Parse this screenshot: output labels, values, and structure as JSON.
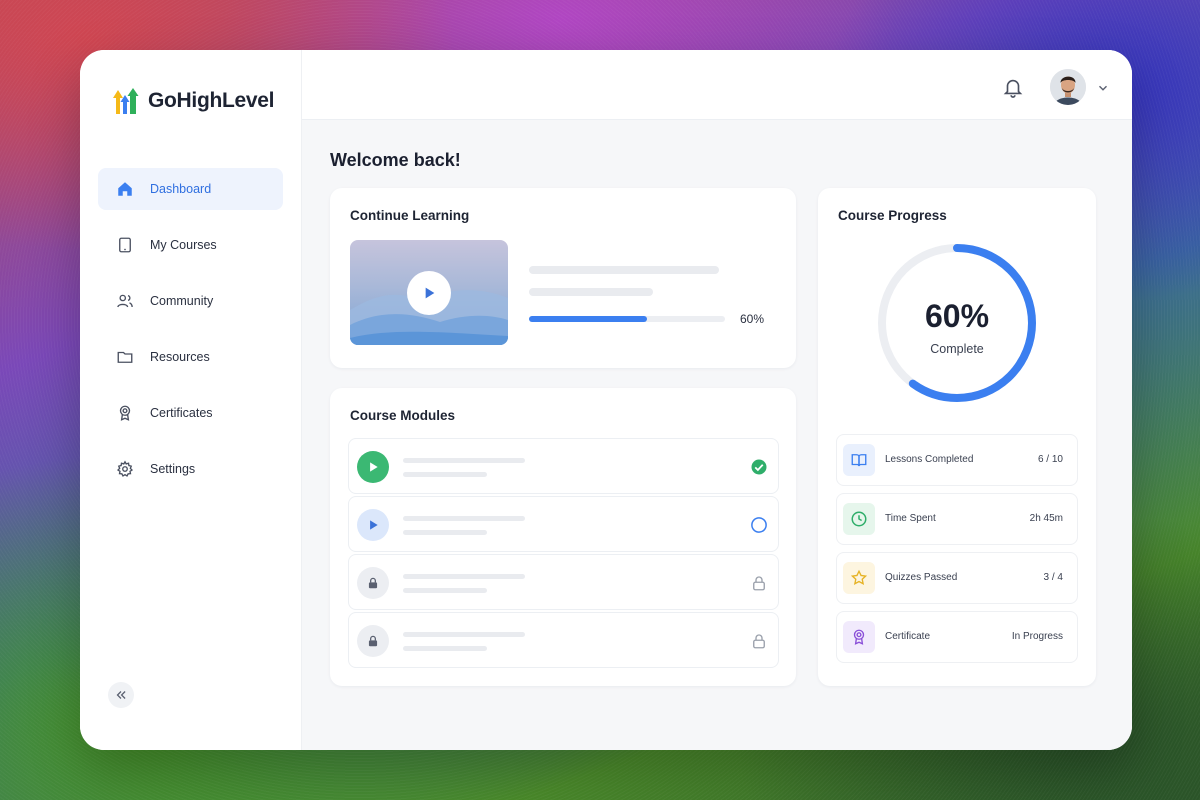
{
  "brand": {
    "name": "GoHighLevel"
  },
  "sidebar": {
    "items": [
      {
        "label": "Dashboard",
        "icon": "home-icon",
        "active": true
      },
      {
        "label": "My Courses",
        "icon": "tablet-icon"
      },
      {
        "label": "Community",
        "icon": "users-icon"
      },
      {
        "label": "Resources",
        "icon": "folder-icon"
      },
      {
        "label": "Certificates",
        "icon": "award-icon"
      },
      {
        "label": "Settings",
        "icon": "gear-icon"
      }
    ],
    "collapse_icon": "chevrons-left-icon"
  },
  "header": {
    "notifications_icon": "bell-icon",
    "avatar_icon": "avatar",
    "menu_icon": "chevron-down-icon"
  },
  "main": {
    "welcome": "Welcome back!",
    "continue_learning": {
      "title": "Continue Learning",
      "progress": 0.6,
      "progress_label": "60%"
    },
    "course_modules": {
      "title": "Course Modules",
      "modules": [
        {
          "state": "completed",
          "icon": "play-icon",
          "status_icon": "check-circle-icon"
        },
        {
          "state": "in-progress",
          "icon": "play-icon",
          "status_icon": "circle-icon"
        },
        {
          "state": "locked",
          "icon": "lock-icon",
          "status_icon": "lock-icon"
        },
        {
          "state": "locked",
          "icon": "lock-icon",
          "status_icon": "lock-icon"
        }
      ]
    },
    "course_progress": {
      "title": "Course Progress",
      "percent": 60,
      "percent_label": "60%",
      "sub_label": "Complete",
      "stats": [
        {
          "label": "Lessons Completed",
          "value": "6 / 10",
          "icon": "book-icon",
          "color": "#3b7ff0"
        },
        {
          "label": "Time Spent",
          "value": "2h 45m",
          "icon": "clock-icon",
          "color": "#2fae6a"
        },
        {
          "label": "Quizzes Passed",
          "value": "3 / 4",
          "icon": "star-icon",
          "color": "#e6b325"
        },
        {
          "label": "Certificate",
          "value": "In Progress",
          "icon": "award-icon",
          "color": "#8a4fd8"
        }
      ]
    }
  },
  "colors": {
    "accent": "#3b7ff0",
    "success": "#2fae6a",
    "ring_track": "#eceef2"
  }
}
